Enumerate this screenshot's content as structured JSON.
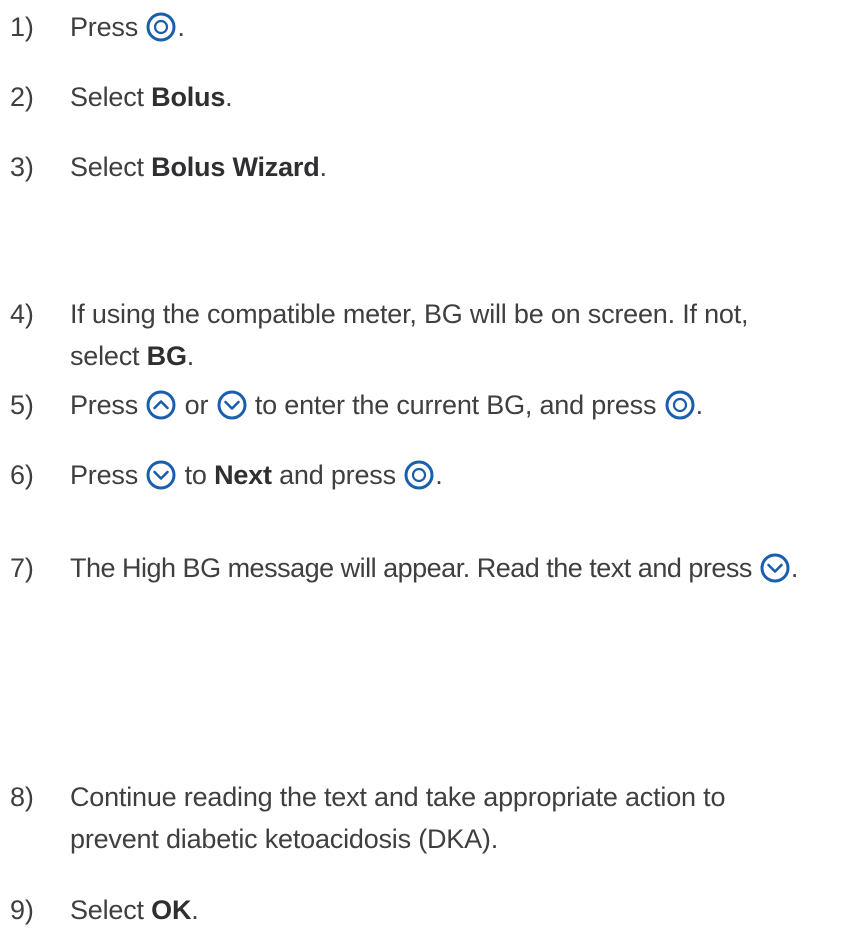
{
  "icons": {
    "select": "select-button-icon",
    "up": "up-arrow-button-icon",
    "down": "down-arrow-button-icon"
  },
  "colors": {
    "icon_stroke": "#1a5fae",
    "text": "#3f3f42"
  },
  "steps": [
    {
      "num": "1)",
      "a": "Press ",
      "b": "."
    },
    {
      "num": "2)",
      "a": "Select ",
      "bold": "Bolus",
      "b": "."
    },
    {
      "num": "3)",
      "a": "Select ",
      "bold": "Bolus Wizard",
      "b": "."
    },
    {
      "num": "4)",
      "a": "If using the compatible meter, BG will be on screen. If not,",
      "a2": "select ",
      "bold": "BG",
      "b": "."
    },
    {
      "num": "5)",
      "a": "Press ",
      "b": " or ",
      "c": " to enter the current BG, and press ",
      "d": "."
    },
    {
      "num": "6)",
      "a": "Press ",
      "b": " to ",
      "bold": "Next",
      "c": " and press ",
      "d": "."
    },
    {
      "num": "7)",
      "a": "The High BG message will appear. Read the text and press ",
      "b": "."
    },
    {
      "num": "8)",
      "a": "Continue reading the text and take appropriate action to",
      "a2": "prevent diabetic ketoacidosis (DKA)."
    },
    {
      "num": "9)",
      "a": "Select ",
      "bold": "OK",
      "b": "."
    }
  ]
}
